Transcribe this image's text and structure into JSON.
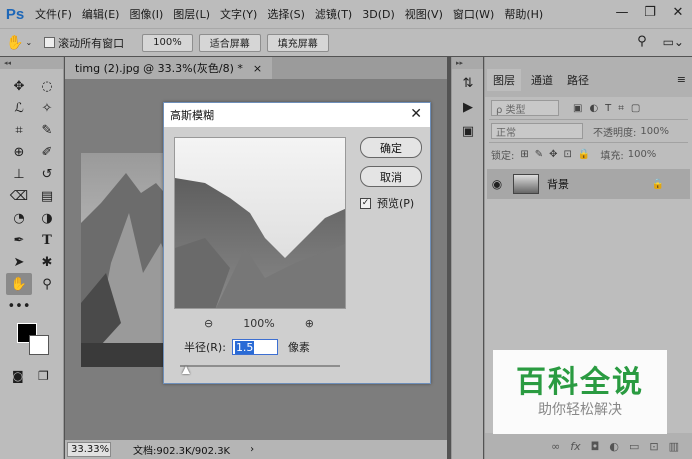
{
  "app": {
    "logo": "Ps"
  },
  "menu": [
    "文件(F)",
    "编辑(E)",
    "图像(I)",
    "图层(L)",
    "文字(Y)",
    "选择(S)",
    "滤镜(T)",
    "3D(D)",
    "视图(V)",
    "窗口(W)",
    "帮助(H)"
  ],
  "window_controls": {
    "minimize": "—",
    "restore": "❐",
    "close": "✕"
  },
  "options_bar": {
    "scroll_all_label": "滚动所有窗口",
    "zoom_100": "100%",
    "fit_screen": "适合屏幕",
    "fill_screen": "填充屏幕"
  },
  "document": {
    "tab_title": "timg (2).jpg @ 33.3%(灰色/8) *",
    "tab_close": "×",
    "status_zoom": "33.33%",
    "status_doc": "文档:902.3K/902.3K",
    "status_arrow": "›"
  },
  "layers_panel": {
    "tabs": [
      "图层",
      "通道",
      "路径"
    ],
    "filter_label": "ρ 类型",
    "blend_mode": "正常",
    "opacity_label": "不透明度:",
    "opacity_value": "100%",
    "lock_label": "锁定:",
    "fill_label": "填充:",
    "fill_value": "100%",
    "layer_name": "背景"
  },
  "dialog": {
    "title": "高斯模糊",
    "ok": "确定",
    "cancel": "取消",
    "preview_label": "预览(P)",
    "preview_checked": "✓",
    "zoom_value": "100%",
    "radius_label": "半径(R):",
    "radius_value": "1.5",
    "radius_unit": "像素",
    "slider_fraction": 0.04
  },
  "watermark": {
    "title": "百科全说",
    "subtitle": "助你轻松解决"
  },
  "icons": {
    "hand": "hand-icon",
    "search": "search-icon",
    "zoom_in": "zoom-in-icon",
    "zoom_out": "zoom-out-icon",
    "eye": "eye-icon",
    "lock": "lock-icon"
  },
  "colors": {
    "accent": "#2a6bd6",
    "watermark_green": "#2a9b41",
    "logo_blue": "#1d67b8"
  }
}
